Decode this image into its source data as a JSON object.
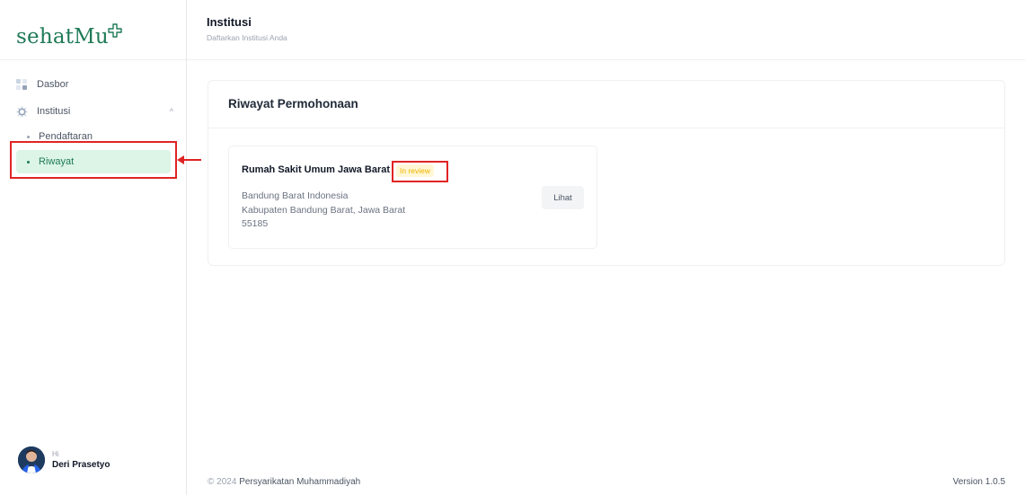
{
  "app": {
    "logo_text": "sehatMu",
    "brand_color": "#1f7a57",
    "highlight_color": "#e02424"
  },
  "sidebar": {
    "items": [
      {
        "label": "Dasbor",
        "icon": "grid-icon"
      },
      {
        "label": "Institusi",
        "icon": "gear-icon",
        "expanded": true,
        "children": [
          {
            "label": "Pendaftaran",
            "active": false
          },
          {
            "label": "Riwayat",
            "active": true
          }
        ]
      }
    ],
    "chevron": "^"
  },
  "user": {
    "greeting": "Hi",
    "name": "Deri Prasetyo"
  },
  "header": {
    "title": "Institusi",
    "subtitle": "Daftarkan Institusi Anda"
  },
  "main": {
    "card_title": "Riwayat Permohonaan",
    "application": {
      "name": "Rumah Sakit Umum Jawa Barat",
      "status": "In review",
      "address_line1": "Bandung Barat Indonesia",
      "address_line2": "Kabupaten Bandung Barat, Jawa Barat",
      "postal_code": "55185",
      "action_label": "Lihat"
    }
  },
  "footer": {
    "copyright_symbol": "©",
    "year": "2024",
    "org": "Persyarikatan Muhammadiyah",
    "version": "Version 1.0.5"
  }
}
